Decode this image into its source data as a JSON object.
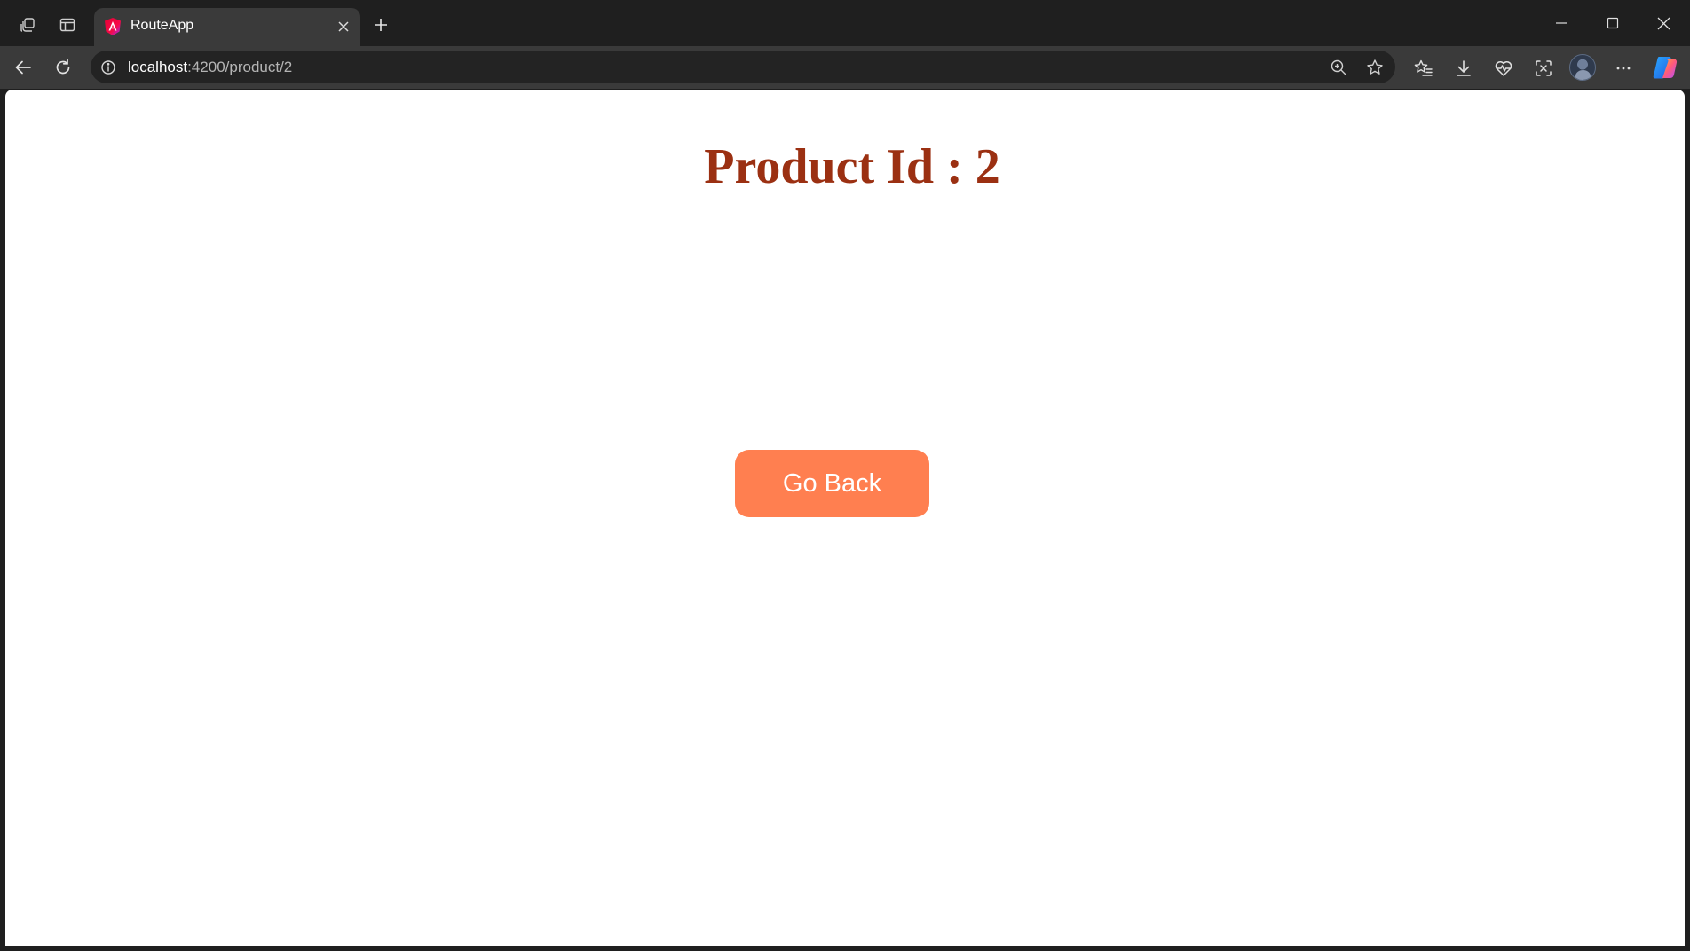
{
  "browser": {
    "tab": {
      "title": "RouteApp",
      "favicon": "angular-icon"
    },
    "address_bar": {
      "host": "localhost",
      "path": ":4200/product/2"
    },
    "icons": {
      "workspaces": "workspaces-icon",
      "tab_actions": "vertical-tabs-icon",
      "new_tab": "plus-icon",
      "minimize": "minimize-icon",
      "maximize": "maximize-icon",
      "close": "close-icon",
      "back": "back-arrow-icon",
      "refresh": "refresh-icon",
      "site_info": "info-icon",
      "zoom": "zoom-icon",
      "favorite": "star-icon",
      "favorites": "favorites-icon",
      "downloads": "download-icon",
      "browser_essentials": "heartbeat-icon",
      "screenshot": "screenshot-icon",
      "profile": "profile-avatar",
      "more": "more-icon",
      "copilot": "copilot-icon"
    }
  },
  "page": {
    "title": "Product Id : 2",
    "go_back_label": "Go Back"
  },
  "colors": {
    "title": "#9b3012",
    "button_bg": "#ff7f50",
    "button_text": "#ffffff",
    "chrome_dark": "#1f1f1f",
    "chrome_mid": "#3a3a3a"
  }
}
